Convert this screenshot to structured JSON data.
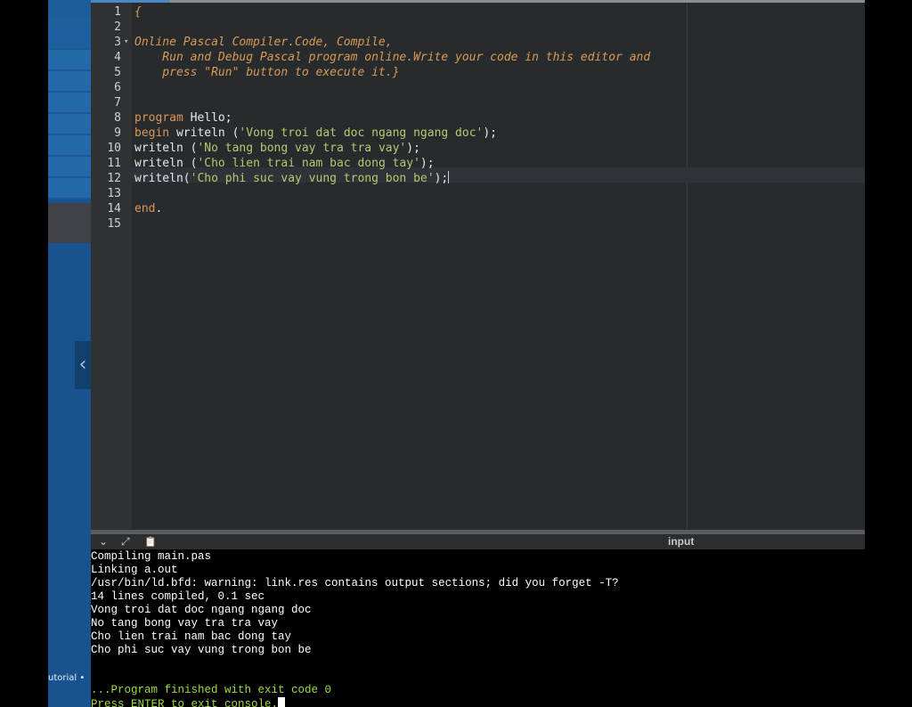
{
  "sidebar": {
    "collapse_icon": "chevron-left-icon",
    "collapse_glyph": "‹",
    "tutorial_label": "utorial •"
  },
  "editor": {
    "line_numbers": [
      "1",
      "2",
      "3",
      "4",
      "5",
      "6",
      "7",
      "8",
      "9",
      "10",
      "11",
      "12",
      "13",
      "14",
      "15"
    ],
    "lines": {
      "l1": "{",
      "l3": "Online Pascal Compiler.Code, Compile,",
      "l4": "    Run and Debug Pascal program online.Write your code in this editor and",
      "l5": "    press \"Run\" button to execute it.}",
      "l8_kw": "program",
      "l8_txt": " Hello;",
      "l9_kw": "begin",
      "l9_txt": " writeln (",
      "l9_str": "'Vong troi dat doc ngang ngang doc'",
      "l9_end": ");",
      "l10_txt": "writeln (",
      "l10_str": "'No tang bong vay tra tra vay'",
      "l10_end": ");",
      "l11_txt": "writeln (",
      "l11_str": "'Cho lien trai nam bac dong tay'",
      "l11_end": ");",
      "l12_txt": "writeln(",
      "l12_str": "'Cho phi suc vay vung trong bon be'",
      "l12_end": ");",
      "l14_kw": "end",
      "l14_txt": "."
    }
  },
  "console_toolbar": {
    "collapse_icon": "chevron-down-icon",
    "collapse_glyph": "⌄",
    "expand_icon": "expand-icon",
    "expand_glyph": "⤢",
    "copy_icon": "clipboard-icon",
    "copy_glyph": "📋",
    "input_label": "input"
  },
  "console": {
    "lines": [
      "Compiling main.pas",
      "Linking a.out",
      "/usr/bin/ld.bfd: warning: link.res contains output sections; did you forget -T?",
      "14 lines compiled, 0.1 sec",
      "Vong troi dat doc ngang ngang doc",
      "No tang bong vay tra tra vay",
      "Cho lien trai nam bac dong tay",
      "Cho phi suc vay vung trong bon be"
    ],
    "finished": "...Program finished with exit code 0",
    "press_enter": "Press ENTER to exit console."
  }
}
